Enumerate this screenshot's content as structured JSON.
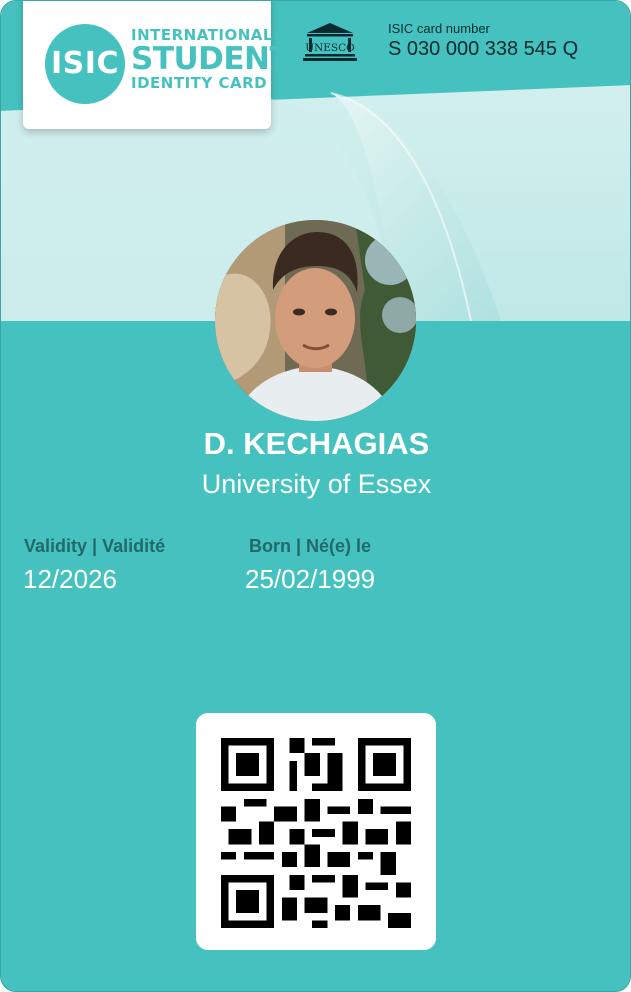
{
  "logo": {
    "abbr": "ISIC",
    "line1": "INTERNATIONAL",
    "line2": "STUDENT",
    "line3": "IDENTITY CARD"
  },
  "partner_logo": {
    "text": "UNESCO"
  },
  "card_number": {
    "label": "ISIC card number",
    "value": "S 030 000 338 545 Q"
  },
  "holder": {
    "name": "D. KECHAGIAS",
    "institution": "University of Essex"
  },
  "validity": {
    "label": "Validity | Validité",
    "value": "12/2026"
  },
  "born": {
    "label": "Born | Né(e) le",
    "value": "25/02/1999"
  },
  "colors": {
    "teal": "#45c2bf",
    "label_dark_teal": "#22696a",
    "text_dark": "#0b2a2f"
  }
}
